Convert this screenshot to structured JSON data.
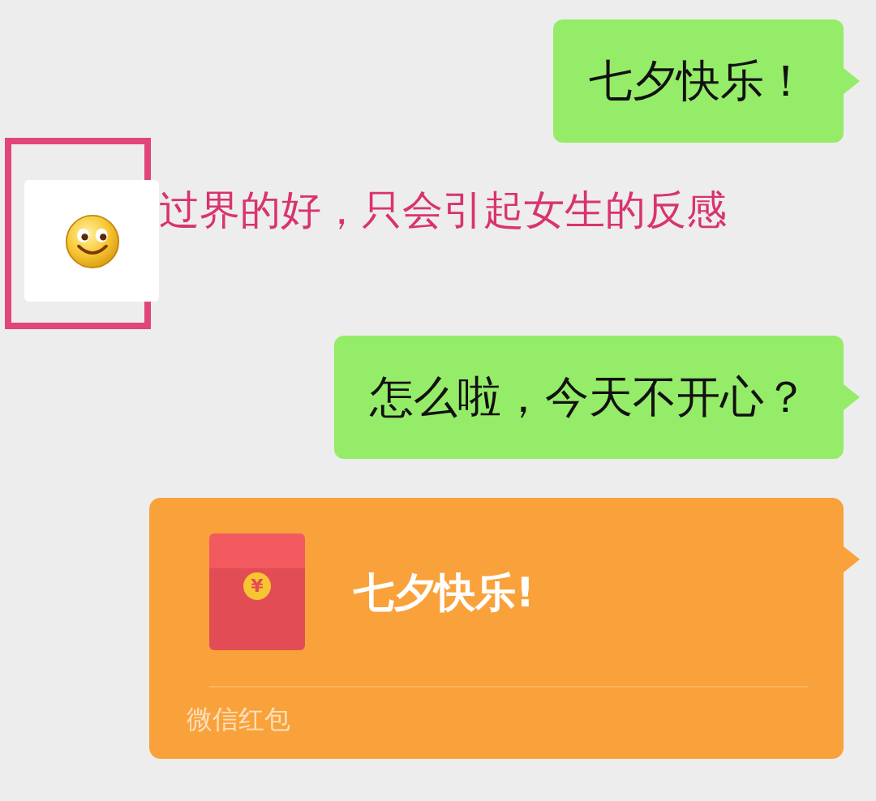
{
  "messages": [
    {
      "kind": "text",
      "outgoing": true,
      "text": "七夕快乐！"
    },
    {
      "kind": "sticker",
      "outgoing": false,
      "highlighted": true,
      "annotation": "过界的好，只会引起女生的反感"
    },
    {
      "kind": "text",
      "outgoing": true,
      "text": "怎么啦，今天不开心？"
    },
    {
      "kind": "red_packet",
      "outgoing": true,
      "symbol": "¥",
      "title": "七夕快乐!",
      "footer": "微信红包"
    }
  ]
}
